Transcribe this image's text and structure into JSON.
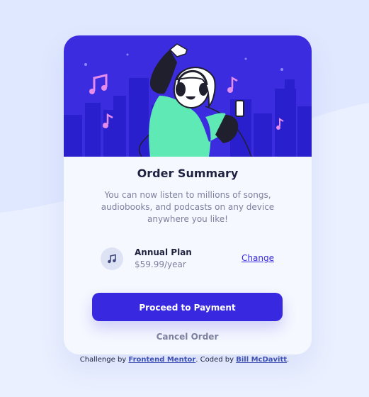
{
  "colors": {
    "page_background": "#e0e8ff",
    "card_background": "#f5f8ff",
    "hero_background": "#3b2ce0",
    "accent": "#3829e0",
    "text_dark": "#1f2340",
    "text_muted": "#7c809e"
  },
  "card": {
    "hero_illustration": "music-listener-illustration",
    "title": "Order Summary",
    "description": "You can now listen to millions of songs, audiobooks, and podcasts on any device anywhere you like!",
    "plan": {
      "icon": "music-note-icon",
      "name": "Annual Plan",
      "price": "$59.99/year",
      "change_label": "Change"
    },
    "proceed_label": "Proceed to Payment",
    "cancel_label": "Cancel Order"
  },
  "attribution": {
    "prefix": "Challenge by",
    "frontend_mentor": "Frontend Mentor",
    "middle": ". Coded by",
    "author": "Bill McDavitt",
    "suffix": "."
  }
}
